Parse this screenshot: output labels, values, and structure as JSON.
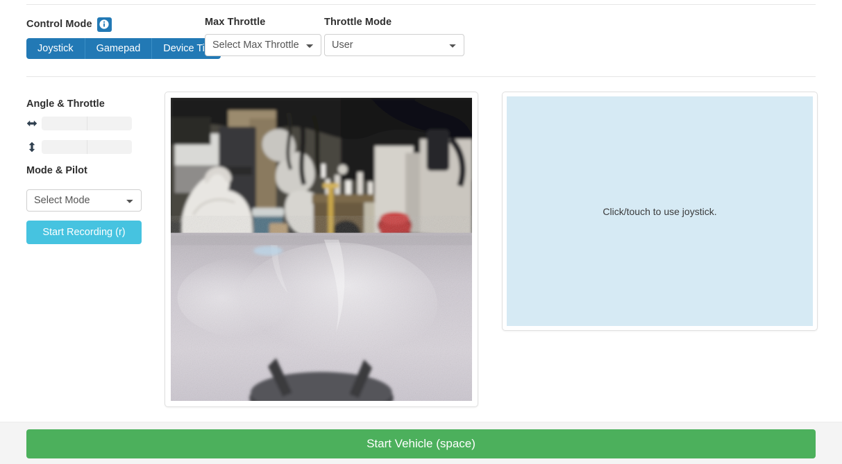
{
  "control_mode": {
    "label": "Control Mode",
    "info_icon": "info-circle-icon",
    "options": [
      {
        "label": "Joystick",
        "active": true
      },
      {
        "label": "Gamepad",
        "active": false
      },
      {
        "label": "Device Tilt",
        "active": false
      }
    ]
  },
  "max_throttle": {
    "label": "Max Throttle",
    "selected": "Select Max Throttle"
  },
  "throttle_mode": {
    "label": "Throttle Mode",
    "selected": "User"
  },
  "angle_throttle": {
    "title": "Angle & Throttle",
    "angle": {
      "icon": "left-right-arrow-icon",
      "value": 0,
      "fill_percent": 0
    },
    "throttle": {
      "icon": "up-down-arrow-icon",
      "value": 0,
      "fill_percent": 0
    }
  },
  "mode_pilot": {
    "title": "Mode & Pilot",
    "selected": "Select Mode",
    "record_button": "Start Recording (r)"
  },
  "camera": {
    "name": "camera-feed",
    "alt": "Live camera feed of cluttered garage floor"
  },
  "joystick": {
    "hint": "Click/touch to use joystick."
  },
  "bottom": {
    "start_button": "Start Vehicle (space)"
  },
  "colors": {
    "primary_blue": "#2279b5",
    "record_cyan": "#46c3e0",
    "start_green": "#4cb05c",
    "joystick_bg": "#d6eaf4",
    "meter_bg": "#f2f2f2",
    "bottom_bar_bg": "#f4f4f4"
  }
}
